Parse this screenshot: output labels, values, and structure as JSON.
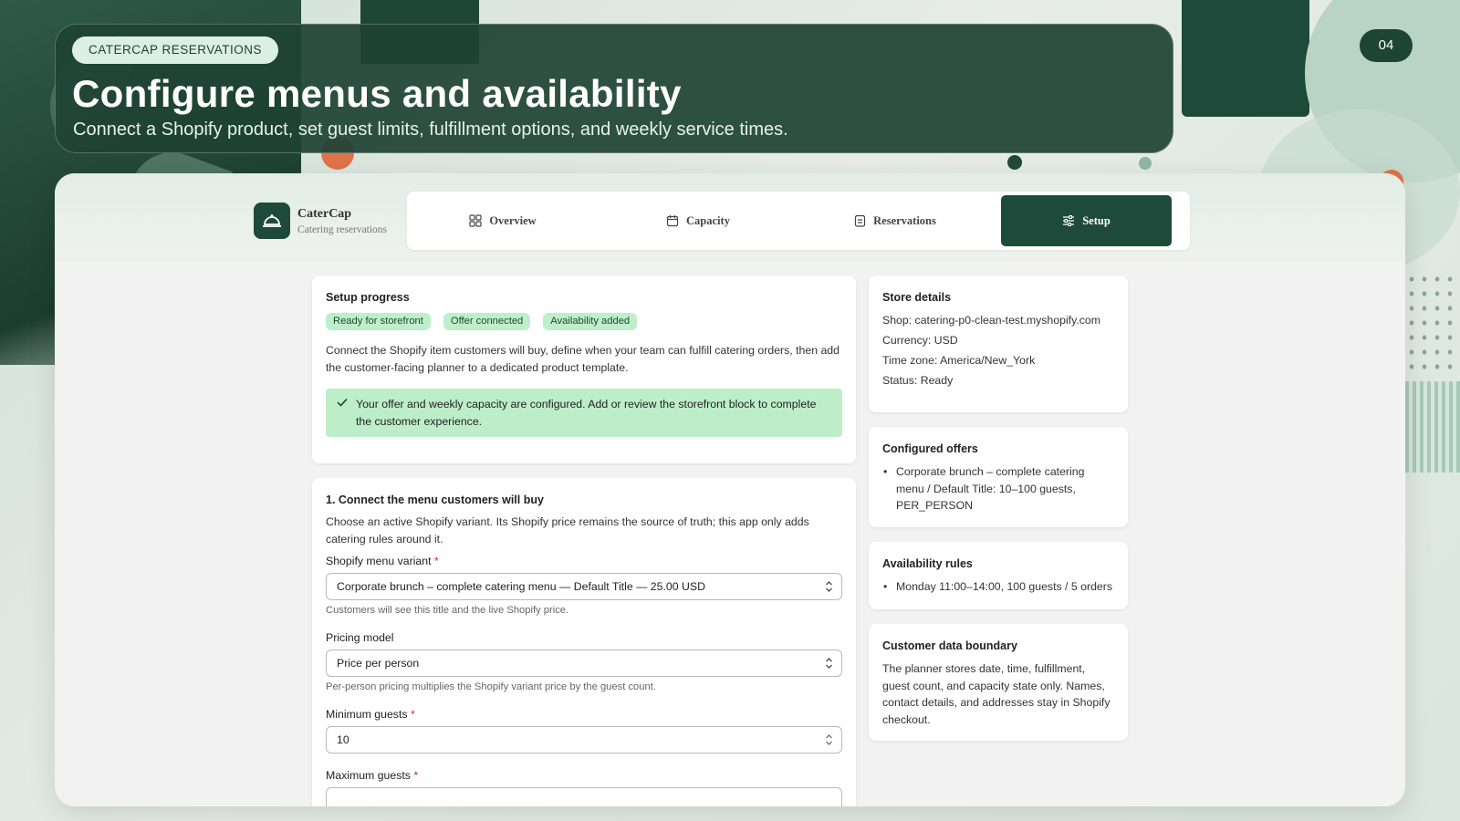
{
  "header": {
    "pill": "CATERCAP RESERVATIONS",
    "title": "Configure menus and availability",
    "subtitle": "Connect a Shopify product, set guest limits, fulfillment options, and weekly service times.",
    "page_number": "04"
  },
  "brand": {
    "name": "CaterCap",
    "tagline": "Catering reservations"
  },
  "nav": {
    "tabs": [
      {
        "label": "Overview",
        "icon": "grid-icon"
      },
      {
        "label": "Capacity",
        "icon": "calendar-icon"
      },
      {
        "label": "Reservations",
        "icon": "clipboard-icon"
      },
      {
        "label": "Setup",
        "icon": "sliders-icon",
        "active": true
      }
    ]
  },
  "progress": {
    "title": "Setup progress",
    "badges": [
      "Ready for storefront",
      "Offer connected",
      "Availability added"
    ],
    "description": "Connect the Shopify item customers will buy, define when your team can fulfill catering orders, then add the customer-facing planner to a dedicated product template.",
    "success_message": "Your offer and weekly capacity are configured. Add or review the storefront block to complete the customer experience."
  },
  "menu_section": {
    "title": "1. Connect the menu customers will buy",
    "description": "Choose an active Shopify variant. Its Shopify price remains the source of truth; this app only adds catering rules around it.",
    "variant_label": "Shopify menu variant",
    "variant_value": "Corporate brunch – complete catering menu — Default Title — 25.00 USD",
    "variant_help": "Customers will see this title and the live Shopify price.",
    "pricing_label": "Pricing model",
    "pricing_value": "Price per person",
    "pricing_help": "Per-person pricing multiplies the Shopify variant price by the guest count.",
    "min_label": "Minimum guests",
    "min_value": "10",
    "max_label": "Maximum guests",
    "required_mark": "*"
  },
  "store": {
    "title": "Store details",
    "shop": "Shop: catering-p0-clean-test.myshopify.com",
    "currency": "Currency: USD",
    "timezone": "Time zone: America/New_York",
    "status": "Status: Ready"
  },
  "offers": {
    "title": "Configured offers",
    "items": [
      "Corporate brunch – complete catering menu / Default Title: 10–100 guests, PER_PERSON"
    ]
  },
  "rules": {
    "title": "Availability rules",
    "items": [
      "Monday 11:00–14:00, 100 guests / 5 orders"
    ]
  },
  "boundary": {
    "title": "Customer data boundary",
    "text": "The planner stores date, time, fulfillment, guest count, and capacity state only. Names, contact details, and addresses stay in Shopify checkout."
  },
  "colors": {
    "brand_dark": "#1e4a3b",
    "badge_green": "#bfeecb",
    "success_green": "#bdeec9",
    "required_red": "#d12a2a"
  }
}
